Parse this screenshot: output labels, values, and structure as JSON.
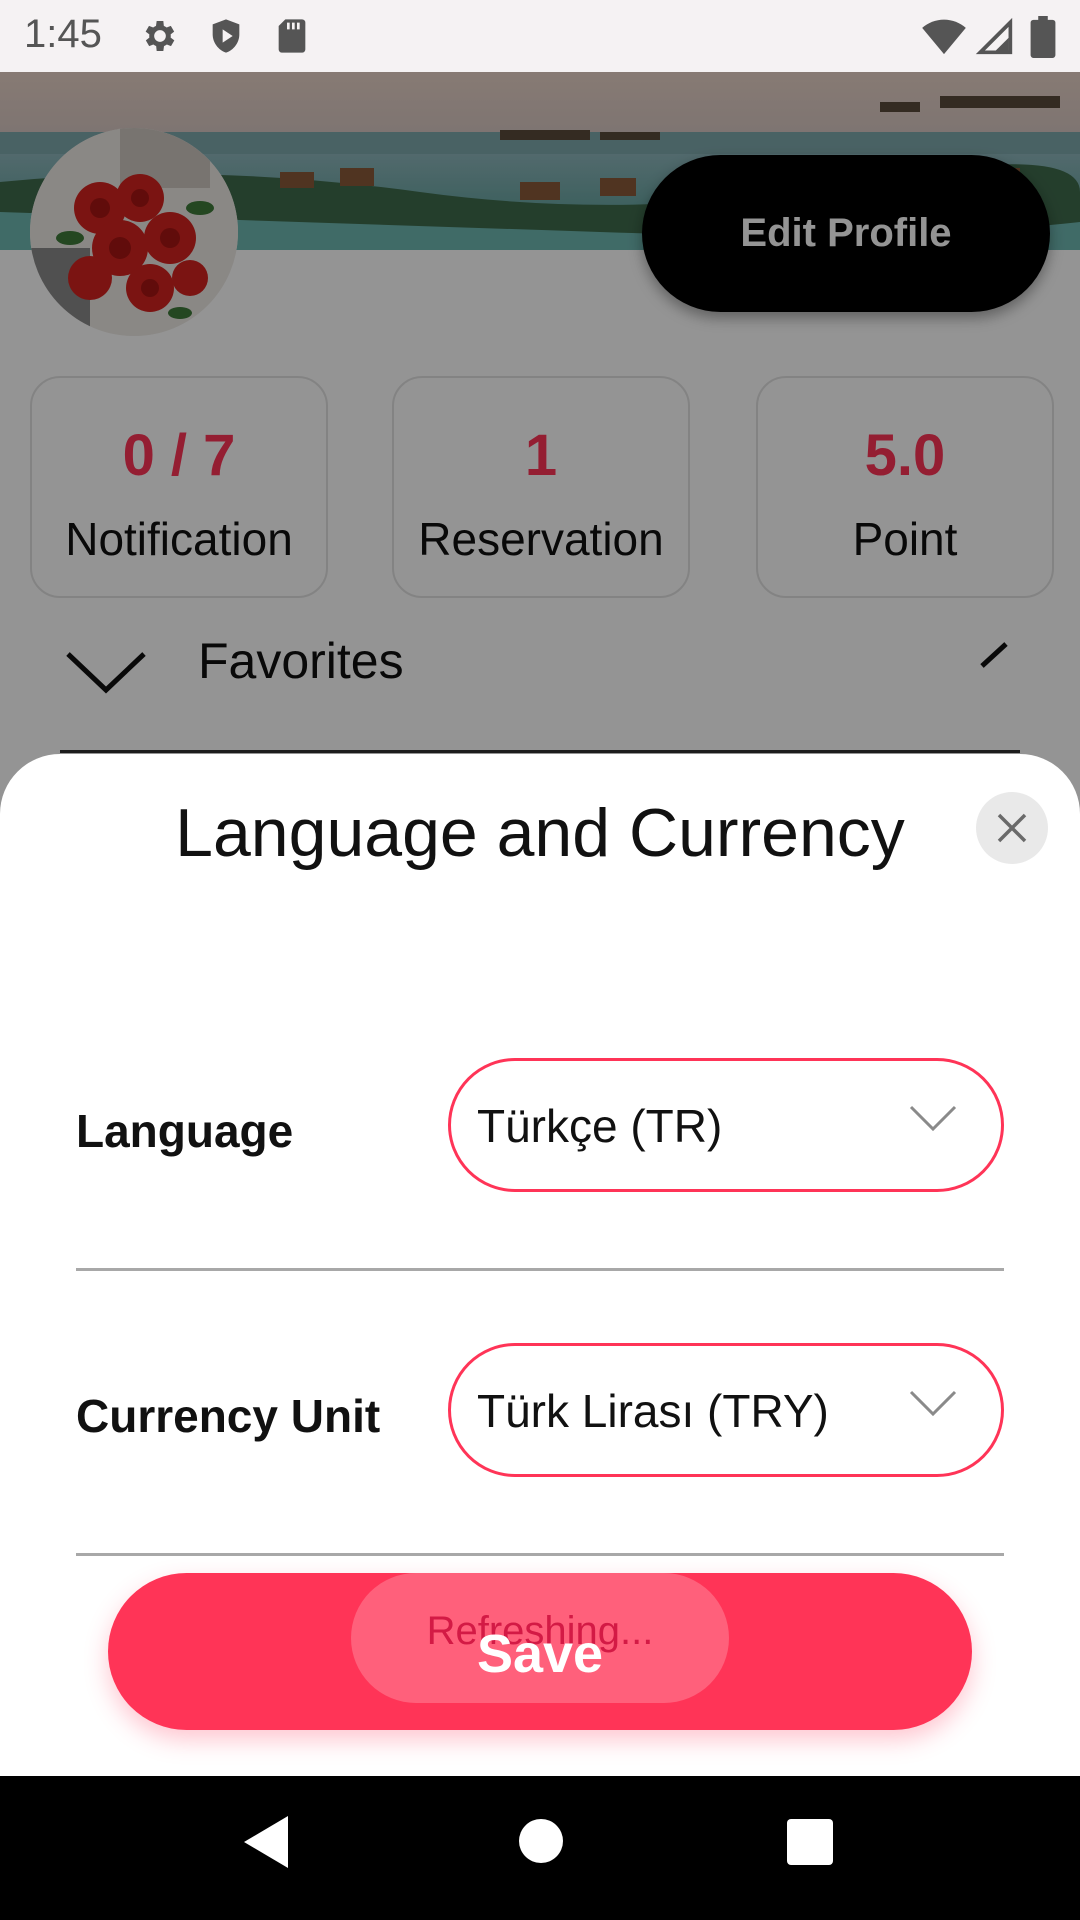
{
  "status_bar": {
    "time": "1:45",
    "left_icons": [
      "gear-icon",
      "shield-play-icon",
      "sd-card-icon"
    ],
    "right_icons": [
      "wifi-icon",
      "cellular-signal-icon",
      "battery-icon"
    ]
  },
  "profile": {
    "edit_profile_label": "Edit Profile",
    "stats": [
      {
        "value": "0 / 7",
        "label": "Notification"
      },
      {
        "value": "1",
        "label": "Reservation"
      },
      {
        "value": "5.0",
        "label": "Point"
      }
    ],
    "favorites_label": "Favorites"
  },
  "sheet": {
    "title": "Language and Currency",
    "language": {
      "label": "Language",
      "value": "Türkçe (TR)"
    },
    "currency": {
      "label": "Currency Unit",
      "value": "Türk Lirası (TRY)"
    },
    "save_label": "Save",
    "refresh_text": "Refreshing..."
  },
  "colors": {
    "accent": "#ff3457",
    "dim_overlay": "rgba(0,0,0,0.42)"
  },
  "nav_bar": {
    "icons": [
      "back-icon",
      "home-icon",
      "recents-icon"
    ]
  }
}
